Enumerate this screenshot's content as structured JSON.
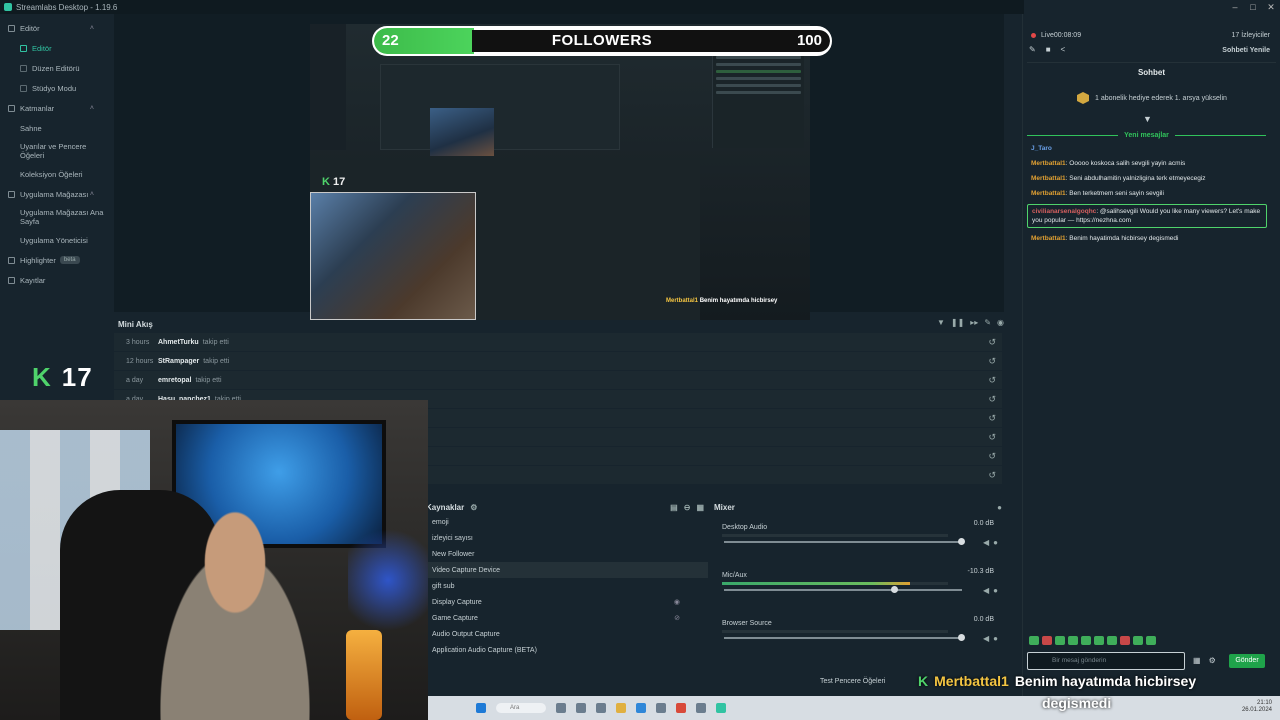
{
  "window": {
    "title": "Streamlabs Desktop - 1.19.6",
    "minimize": "–",
    "maximize": "□",
    "close": "✕"
  },
  "sidebar": {
    "items": [
      {
        "label": "Editör",
        "chev": "˄"
      },
      {
        "label": "Editör"
      },
      {
        "label": "Düzen Editörü"
      },
      {
        "label": "Stüdyo Modu"
      },
      {
        "label": "Katmanlar",
        "chev": "˄"
      },
      {
        "label": "Sahne"
      },
      {
        "label": "Uyarılar ve Pencere Öğeleri"
      },
      {
        "label": "Koleksiyon Öğeleri"
      },
      {
        "label": "Uygulama Mağazası",
        "chev": "˄"
      },
      {
        "label": "Uygulama Mağazası Ana Sayfa"
      },
      {
        "label": "Uygulama Yöneticisi"
      },
      {
        "label": "Highlighter",
        "badge": "beta"
      },
      {
        "label": "Kayıtlar"
      }
    ]
  },
  "goal": {
    "current": "22",
    "label": "FOLLOWERS",
    "max": "100",
    "progress": 0.22
  },
  "preview": {
    "k_label": "K",
    "k_value": "17",
    "msg_user": "Mertbattal1",
    "msg_text": "Benim hayatımda hicbirsey"
  },
  "minifeed": {
    "title": "Mini Akış",
    "rows": [
      {
        "time": "3 hours",
        "user": "AhmetTurku",
        "action": "takip etti"
      },
      {
        "time": "12 hours",
        "user": "StRampager",
        "action": "takip etti"
      },
      {
        "time": "a day",
        "user": "emretopal",
        "action": "takip etti"
      },
      {
        "time": "a day",
        "user": "Hasu_nanchez1",
        "action": "takip etti"
      },
      {
        "time": "",
        "user": "",
        "action": ""
      },
      {
        "time": "",
        "user": "",
        "action": ""
      },
      {
        "time": "",
        "user": "",
        "action": ""
      },
      {
        "time": "",
        "user": "",
        "action": ""
      }
    ]
  },
  "sources": {
    "title": "Kaynaklar",
    "items": [
      {
        "label": "emoji"
      },
      {
        "label": "izleyici sayısı"
      },
      {
        "label": "New Follower"
      },
      {
        "label": "Video Capture Device",
        "selected": true
      },
      {
        "label": "gift sub"
      },
      {
        "label": "Display Capture",
        "right": "◉"
      },
      {
        "label": "Game Capture",
        "right": "⊘"
      },
      {
        "label": "Audio Output Capture"
      },
      {
        "label": "Application Audio Capture (BETA)"
      }
    ]
  },
  "mixer": {
    "title": "Mixer",
    "channels": [
      {
        "name": "Desktop Audio",
        "db": "0.0 dB",
        "level": 0.0,
        "volume": 1.0
      },
      {
        "name": "Mic/Aux",
        "db": "-10.3 dB",
        "level": 0.83,
        "volume": 0.72
      },
      {
        "name": "Browser Source",
        "db": "0.0 dB",
        "level": 0.0,
        "volume": 1.0
      }
    ]
  },
  "footer": {
    "test_widgets": "Test Pencere Öğeleri"
  },
  "chat": {
    "live": "Live00:08:09",
    "viewers": "17 İzleyiciler",
    "refresh": "Sohbeti Yenile",
    "title": "Sohbet",
    "sub_goal": "1 abonelik hediye ederek 1. arsya yükselin",
    "new_messages": "Yeni mesajlar",
    "messages": [
      {
        "user": "J_Taro",
        "text": ""
      },
      {
        "user": "Mertbattal1",
        "text": ": Ooooo koskoca salih sevgili yayin acmis"
      },
      {
        "user": "Mertbattal1",
        "text": ": Seni abdulhamitin yalnizligina terk etmeyecegiz"
      },
      {
        "user": "Mertbattal1",
        "text": ": Ben terketmem seni sayin sevgili"
      },
      {
        "user": "civilianarsenalgoqhc",
        "text": ": @salihsevgili Would you like many viewers? Let's make you popular — https://nezhna.com",
        "highlight": true
      },
      {
        "user": "Mertbattal1",
        "text": ": Benim hayatimda hicbirsey degismedi"
      }
    ],
    "input_placeholder": "Bir mesaj gönderin",
    "send": "Gönder"
  },
  "overlay": {
    "k_label": "K",
    "k_value": "17",
    "alert_user": "Mertbattal1",
    "alert_text_1": "Benim hayatımda hicbirsey",
    "alert_text_2": "degismedi"
  },
  "taskbar": {
    "search": "Ara",
    "time": "21:10",
    "date": "26.01.2024"
  }
}
